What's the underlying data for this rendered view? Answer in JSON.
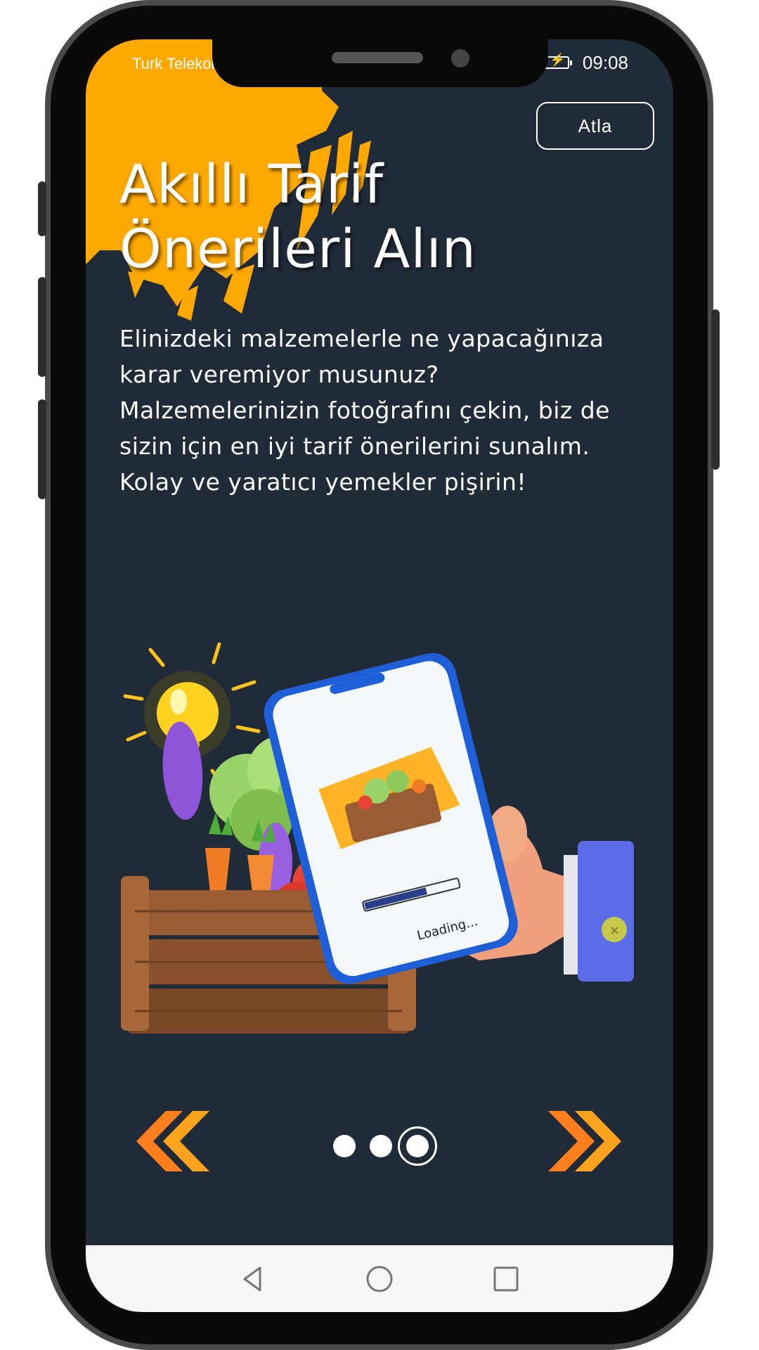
{
  "status_bar": {
    "carrier": "Turk Telekom",
    "time": "09:08",
    "battery_icon": "battery-charging-icon"
  },
  "onboarding": {
    "skip_label": "Atla",
    "title_line1": "Akıllı Tarif",
    "title_line2": "Önerileri Alın",
    "description_lines": [
      "Elinizdeki malzemelerle ne yapacağınıza",
      "karar veremiyor musunuz?",
      "Malzemelerinizin fotoğrafını çekin, biz de",
      "sizin için en iyi tarif önerilerini sunalım.",
      "Kolay ve yaratıcı yemekler pişirin!"
    ],
    "illustration_loading_text": "Loading...",
    "page_indicator": {
      "total": 3,
      "current": 3
    },
    "prev_icon": "double-chevron-left-icon",
    "next_icon": "double-chevron-right-icon"
  },
  "system_nav": {
    "back_icon": "triangle-back-icon",
    "home_icon": "circle-home-icon",
    "recents_icon": "square-recents-icon"
  },
  "colors": {
    "background": "#212b38",
    "accent_orange": "#ffa800",
    "text": "#ffffff"
  }
}
